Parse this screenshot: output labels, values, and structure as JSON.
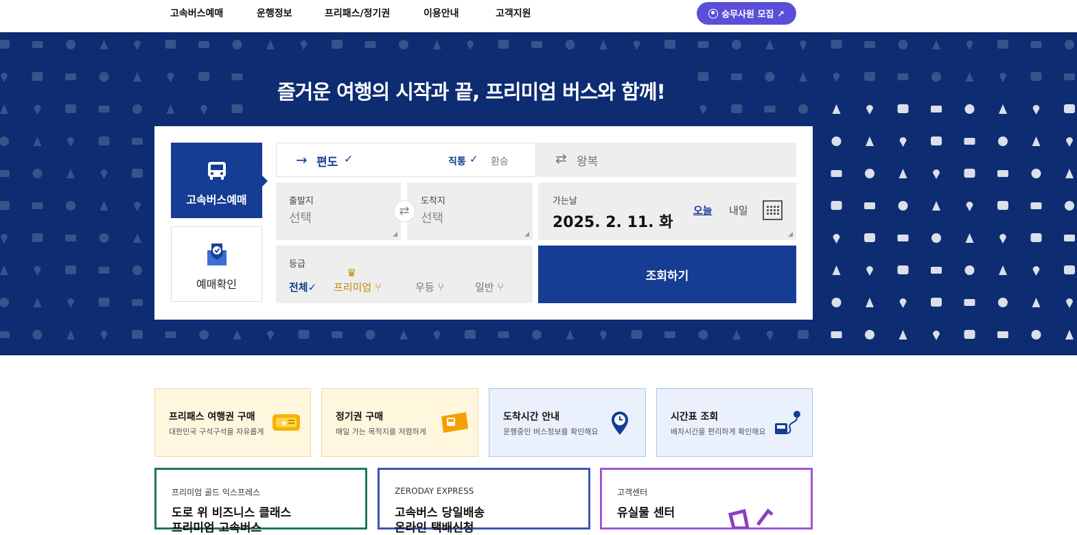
{
  "nav": {
    "items": [
      "고속버스예매",
      "운행정보",
      "프리패스/정기권",
      "이용안내",
      "고객지원"
    ],
    "recruit_label": "승무사원 모집 ↗"
  },
  "hero": {
    "title": "즐거운 여행의 시작과 끝, 프리미엄 버스와 함께!"
  },
  "booking": {
    "tab_bus_label": "고속버스예매",
    "tab_check_label": "예매확인",
    "oneway_label": "편도",
    "check_mark": "✓",
    "direct_label": "직통",
    "transfer_label": "환승",
    "roundtrip_label": "왕복",
    "depart_label": "출발지",
    "depart_value": "선택",
    "arrive_label": "도착지",
    "arrive_value": "선택",
    "date_label": "가는날",
    "date_value": "2025. 2. 11. 화",
    "today_label": "오늘",
    "tomorrow_label": "내일",
    "grade_label": "등급",
    "grades": [
      "전체",
      "프리미엄",
      "우등",
      "일반"
    ],
    "search_label": "조회하기"
  },
  "quick_cards": [
    {
      "title": "프리패스 여행권 구매",
      "desc": "대한민국 구석구석을 자유롭게"
    },
    {
      "title": "정기권 구매",
      "desc": "매일 가는 목적지를 저렴하게"
    },
    {
      "title": "도착시간 안내",
      "desc": "운행중인 버스정보를 확인해요"
    },
    {
      "title": "시간표 조회",
      "desc": "배차시간을 편리하게 확인해요"
    }
  ],
  "promo_cards": [
    {
      "sub": "프리미엄 골드 익스프레스",
      "line1": "도로 위 비즈니스 클래스",
      "line2": "프리미엄 고속버스"
    },
    {
      "sub": "ZERODAY EXPRESS",
      "line1": "고속버스 당일배송",
      "line2": "온라인 택배신청"
    },
    {
      "sub": "고객센터",
      "line1": "유실물 센터",
      "line2": ""
    }
  ],
  "colors": {
    "hero_bg": "#0d2c72",
    "primary": "#143d93",
    "recruit": "#5b4fd8",
    "premium_gold": "#c08a00"
  }
}
